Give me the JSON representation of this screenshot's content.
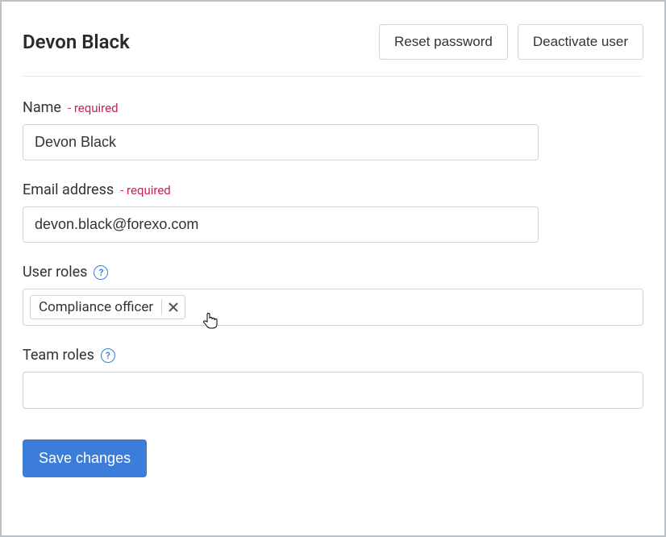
{
  "header": {
    "title": "Devon Black",
    "reset_password_label": "Reset password",
    "deactivate_user_label": "Deactivate user"
  },
  "form": {
    "name": {
      "label": "Name",
      "required_tag": "- required",
      "value": "Devon Black"
    },
    "email": {
      "label": "Email address",
      "required_tag": "- required",
      "value": "devon.black@forexo.com"
    },
    "user_roles": {
      "label": "User roles",
      "tags": [
        {
          "label": "Compliance officer"
        }
      ]
    },
    "team_roles": {
      "label": "Team roles"
    },
    "save_label": "Save changes"
  }
}
